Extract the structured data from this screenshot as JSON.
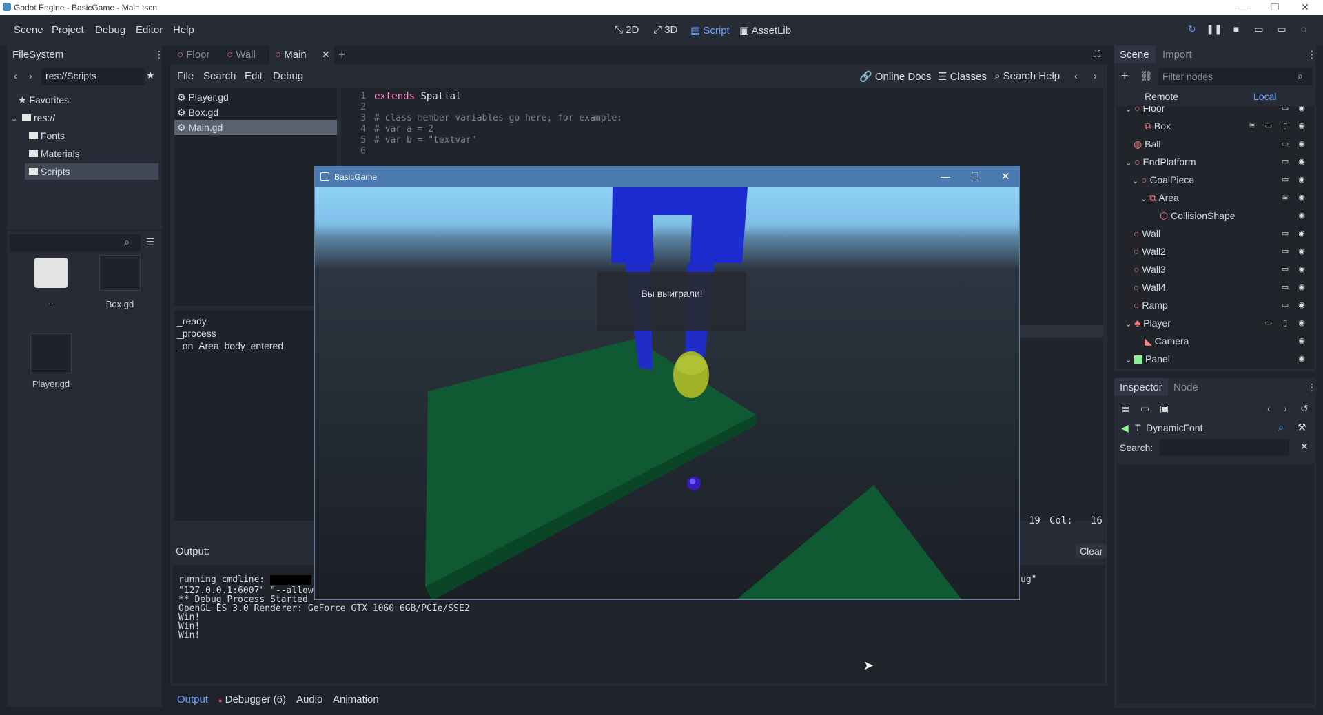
{
  "os_window": {
    "title": "Godot Engine - BasicGame - Main.tscn",
    "minimize": "—",
    "maximize": "❐",
    "close": "✕"
  },
  "menu": {
    "items": [
      "Scene",
      "Project",
      "Debug",
      "Editor",
      "Help"
    ],
    "modes": [
      {
        "label": "2D",
        "icon": "2d-icon"
      },
      {
        "label": "3D",
        "icon": "3d-icon"
      },
      {
        "label": "Script",
        "icon": "script-icon"
      },
      {
        "label": "AssetLib",
        "icon": "assetlib-icon"
      }
    ],
    "active_mode": "Script"
  },
  "filesystem": {
    "title": "FileSystem",
    "path": "res://Scripts",
    "favorites_label": "Favorites:",
    "tree": [
      {
        "label": "res://",
        "depth": 0
      },
      {
        "label": "Fonts",
        "depth": 1
      },
      {
        "label": "Materials",
        "depth": 1
      },
      {
        "label": "Scripts",
        "depth": 1,
        "selected": true
      }
    ],
    "grid": [
      {
        "label": "..",
        "kind": "folder"
      },
      {
        "label": "Box.gd",
        "kind": "script"
      },
      {
        "label": "Player.gd",
        "kind": "script"
      }
    ]
  },
  "scene_tabs": [
    {
      "label": "Floor",
      "active": false
    },
    {
      "label": "Wall",
      "active": false
    },
    {
      "label": "Main",
      "active": true
    }
  ],
  "script_menu": [
    "File",
    "Search",
    "Edit",
    "Debug"
  ],
  "script_help": {
    "online_docs": "Online Docs",
    "classes": "Classes",
    "search_help": "Search Help"
  },
  "script_list": [
    {
      "label": "Player.gd",
      "selected": false
    },
    {
      "label": "Box.gd",
      "selected": false
    },
    {
      "label": "Main.gd",
      "selected": true
    }
  ],
  "methods": [
    "_ready",
    "_process",
    "_on_Area_body_entered"
  ],
  "code": {
    "lines": [
      {
        "n": "1",
        "kw": "extends",
        "text": " Spatial"
      },
      {
        "n": "2",
        "text": ""
      },
      {
        "n": "3",
        "text": "# class member variables go here, for example:"
      },
      {
        "n": "4",
        "text": "# var a = 2"
      },
      {
        "n": "5",
        "text": "# var b = \"textvar\""
      },
      {
        "n": "6",
        "text": ""
      }
    ],
    "status_line": "19",
    "status_col_label": "Col:",
    "status_col": "16"
  },
  "game_window": {
    "title": "BasicGame",
    "message": "Вы выиграли!"
  },
  "output": {
    "title": "Output:",
    "clear": "Clear",
    "tail_fragment": "ug\"",
    "lines": [
      "running cmdline: ",
      "\"127.0.0.1:6007\" \"--allow",
      "** Debug Process Started **",
      "OpenGL ES 3.0 Renderer: GeForce GTX 1060 6GB/PCIe/SSE2",
      "Win!",
      "Win!",
      "Win!"
    ]
  },
  "bottom_tabs": [
    "Output",
    "Debugger (6)",
    "Audio",
    "Animation"
  ],
  "scene_dock": {
    "tabs": [
      "Scene",
      "Import"
    ],
    "filter_placeholder": "Filter nodes",
    "remote": "Remote",
    "local": "Local",
    "nodes": [
      {
        "label": "Floor",
        "depth": 1,
        "icon": "spatial-icon",
        "arrow": true
      },
      {
        "label": "Box",
        "depth": 2,
        "icon": "csg-box-icon"
      },
      {
        "label": "Ball",
        "depth": 1,
        "icon": "rigidbody-icon"
      },
      {
        "label": "EndPlatform",
        "depth": 1,
        "icon": "spatial-icon",
        "arrow": true
      },
      {
        "label": "GoalPiece",
        "depth": 2,
        "icon": "spatial-icon",
        "arrow": true
      },
      {
        "label": "Area",
        "depth": 3,
        "icon": "area-icon",
        "arrow": true
      },
      {
        "label": "CollisionShape",
        "depth": 4,
        "icon": "collision-shape-icon"
      },
      {
        "label": "Wall",
        "depth": 1,
        "icon": "spatial-icon"
      },
      {
        "label": "Wall2",
        "depth": 1,
        "icon": "spatial-icon"
      },
      {
        "label": "Wall3",
        "depth": 1,
        "icon": "spatial-icon"
      },
      {
        "label": "Wall4",
        "depth": 1,
        "icon": "spatial-icon"
      },
      {
        "label": "Ramp",
        "depth": 1,
        "icon": "spatial-icon"
      },
      {
        "label": "Player",
        "depth": 1,
        "icon": "kinematic-body-icon",
        "arrow": true
      },
      {
        "label": "Camera",
        "depth": 2,
        "icon": "camera-icon"
      },
      {
        "label": "Panel",
        "depth": 1,
        "icon": "panel-icon",
        "arrow": true
      }
    ]
  },
  "inspector": {
    "tabs": [
      "Inspector",
      "Node"
    ],
    "resource": "DynamicFont",
    "search_label": "Search:"
  }
}
